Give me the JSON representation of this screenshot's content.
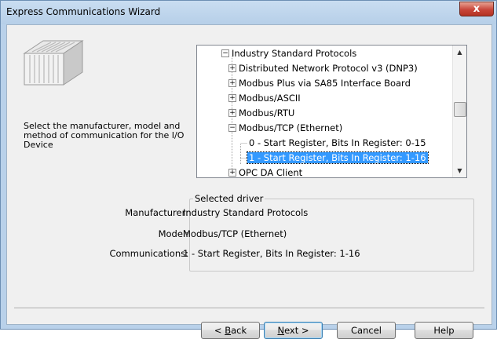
{
  "window": {
    "title": "Express Communications Wizard",
    "close_label": "x"
  },
  "description": "Select the manufacturer, model and method of communication for the I/O Device",
  "tree": {
    "nodes": [
      {
        "label": "Industry Standard Protocols",
        "expander": "−"
      },
      {
        "label": "Distributed Network Protocol v3 (DNP3)",
        "expander": "+"
      },
      {
        "label": "Modbus Plus via SA85 Interface Board",
        "expander": "+"
      },
      {
        "label": "Modbus/ASCII",
        "expander": "+"
      },
      {
        "label": "Modbus/RTU",
        "expander": "+"
      },
      {
        "label": "Modbus/TCP (Ethernet)",
        "expander": "−"
      },
      {
        "label": "0 - Start Register, Bits In Register: 0-15"
      },
      {
        "label": "1 - Start Register, Bits In Register: 1-16",
        "selected": true
      },
      {
        "label": "OPC DA Client",
        "expander": "+"
      }
    ]
  },
  "selected_driver": {
    "legend": "Selected driver",
    "manufacturer_label": "Manufacturer:",
    "manufacturer": "Industry Standard Protocols",
    "model_label": "Model:",
    "model": "Modbus/TCP (Ethernet)",
    "communications_label": "Communications:",
    "communications": "1 - Start Register, Bits In Register: 1-16"
  },
  "buttons": {
    "back": {
      "pre": "< ",
      "key": "B",
      "post": "ack"
    },
    "next": {
      "key": "N",
      "post": "ext >"
    },
    "cancel": "Cancel",
    "help": "Help"
  },
  "colors": {
    "selection": "#3399ff",
    "window_frame": "#b9d1ea",
    "close_button": "#c8463a"
  }
}
